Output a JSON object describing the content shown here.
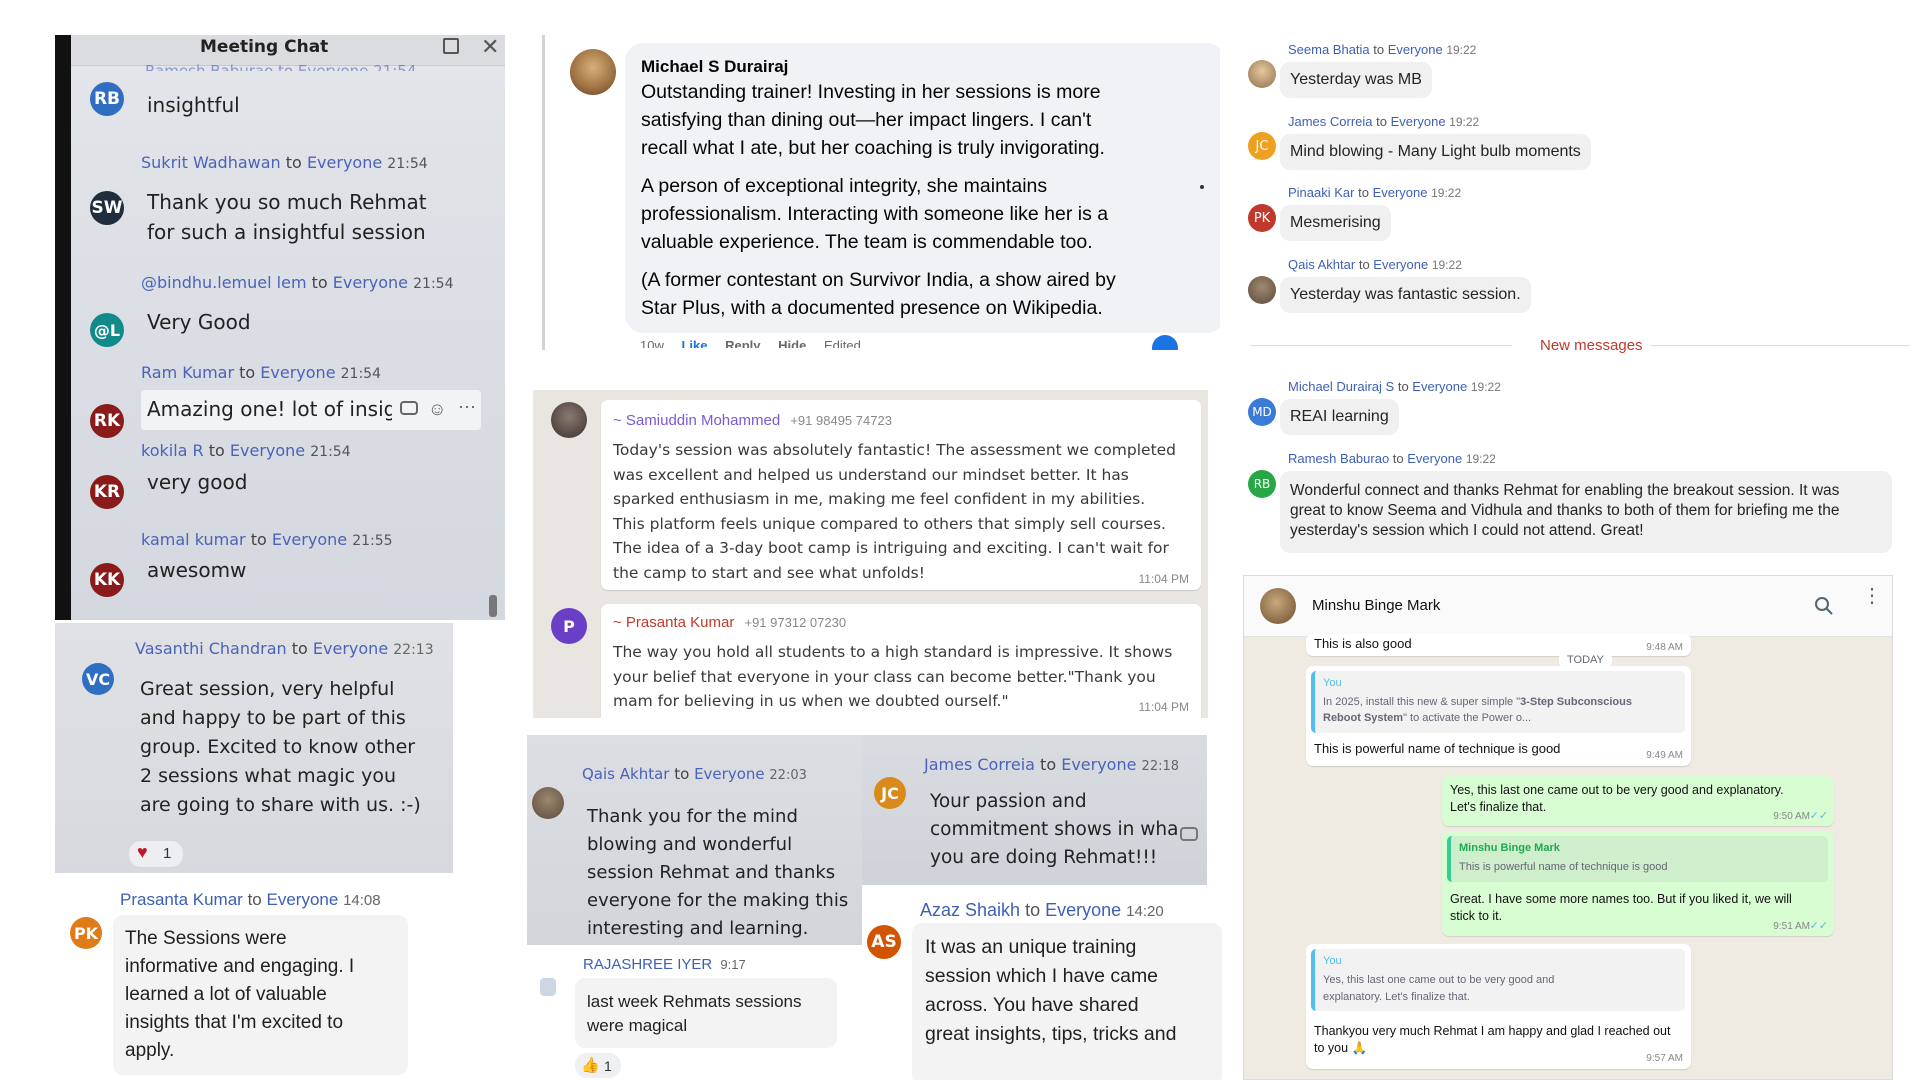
{
  "meeting_chat": {
    "title": "Meeting Chat",
    "cut_sender": "Ramesh Baburao to Everyone 21:54",
    "messages": [
      {
        "initials": "RB",
        "color": "#2f6fc1",
        "sender": "",
        "time": "",
        "text": "insightful"
      },
      {
        "initials": "SW",
        "color": "#1f2d3d",
        "sender": "Sukrit Wadhawan",
        "time": "21:54",
        "text1": "Thank you so much Rehmat",
        "text2": "for such a insightful session"
      },
      {
        "initials": "@L",
        "color": "#128a8a",
        "sender": "@bindhu.lemuel lem",
        "time": "21:54",
        "text": "Very Good"
      },
      {
        "initials": "RK",
        "color": "#8b1a1a",
        "sender": "Ram Kumar",
        "time": "21:54",
        "text": "Amazing one! lot of insig"
      },
      {
        "initials": "KR",
        "color": "#8b1a1a",
        "sender": "kokila R",
        "time": "21:54",
        "text": "very good"
      },
      {
        "initials": "KK",
        "color": "#8b1a1a",
        "sender": "kamal kumar",
        "time": "21:55",
        "text": "awesomw"
      }
    ],
    "to_label": "to",
    "everyone_label": "Everyone"
  },
  "vasanthi": {
    "initials": "VC",
    "sender": "Vasanthi Chandran",
    "time": "22:13",
    "lines": [
      "Great session, very helpful",
      "and happy to be part of this",
      "group. Excited to know other",
      "2 sessions what magic you",
      "are going to share with us. :-)"
    ],
    "reaction_count": "1"
  },
  "prasanta_teams": {
    "initials": "PK",
    "sender": "Prasanta Kumar",
    "time": "14:08",
    "lines": [
      "The  Sessions were",
      "informative and engaging. I",
      "learned a lot of valuable",
      "insights that I'm excited to",
      "apply."
    ]
  },
  "facebook": {
    "author": "Michael S Durairaj",
    "p1": [
      "Outstanding trainer! Investing in her sessions is more",
      "satisfying than dining out—her impact lingers. I can't",
      "recall what I ate, but her coaching is truly invigorating."
    ],
    "p2": [
      "A person of exceptional integrity, she maintains",
      "professionalism. Interacting with someone like her is a",
      "valuable experience. The team is commendable too."
    ],
    "p3": [
      "(A former contestant on Survivor India, a show aired by",
      "Star Plus, with a documented presence on Wikipedia."
    ],
    "footer": [
      "10w",
      "Like",
      "Reply",
      "Hide",
      "Edited"
    ]
  },
  "wa_group": {
    "m1": {
      "sender": "~ Samiuddin Mohammed",
      "phone": "+91 98495 74723",
      "time": "11:04 PM",
      "lines": [
        "Today's session was absolutely fantastic! The assessment we completed",
        "was excellent and helped us understand our mindset better. It has",
        "sparked enthusiasm in me, making me feel confident in my abilities.",
        "This platform feels unique compared to others that simply sell courses.",
        "The idea of a 3-day boot camp is intriguing and exciting. I can't wait for",
        "the camp to start and see what unfolds!"
      ]
    },
    "m2": {
      "initial": "P",
      "sender": "~ Prasanta Kumar",
      "phone": "+91 97312 07230",
      "time": "11:04 PM",
      "lines": [
        "The way you hold all students to a high standard is impressive. It shows",
        "your belief that everyone in your class can become better.\"Thank you",
        "mam for believing in us when we doubted ourself.\""
      ]
    }
  },
  "qais_photo": {
    "sender": "Qais Akhtar",
    "time": "22:03",
    "lines": [
      "Thank you for the mind",
      "blowing and wonderful",
      "session Rehmat and thanks",
      "everyone for the making this",
      "interesting and learning."
    ]
  },
  "james_photo": {
    "initials": "JC",
    "sender": "James Correia",
    "time": "22:18",
    "lines": [
      "Your passion and",
      "commitment shows in wha",
      "you are doing Rehmat!!!"
    ]
  },
  "rajashree": {
    "sender": "RAJASHREE IYER",
    "time": "9:17",
    "lines": [
      "last week Rehmats sessions",
      "were magical"
    ],
    "reaction": "1"
  },
  "azaz": {
    "initials": "AS",
    "sender": "Azaz Shaikh",
    "time": "14:20",
    "lines": [
      "It was an unique training",
      "session which I have came",
      "across. You have shared",
      "great insights, tips, tricks and"
    ]
  },
  "zoom_chat": {
    "messages": [
      {
        "initials": "",
        "color": "#8d6e4a",
        "sender": "Seema Bhatia",
        "time": "19:22",
        "text": "Yesterday was MB"
      },
      {
        "initials": "JC",
        "color": "#f0a020",
        "sender": "James Correia",
        "time": "19:22",
        "text": "Mind blowing - Many Light bulb moments"
      },
      {
        "initials": "PK",
        "color": "#c0392b",
        "sender": "Pinaaki Kar",
        "time": "19:22",
        "text": "Mesmerising"
      },
      {
        "initials": "",
        "color": "#7a6a55",
        "sender": "Qais Akhtar",
        "time": "19:22",
        "text": "Yesterday was fantastic session."
      }
    ],
    "new_messages": "New messages",
    "after": [
      {
        "initials": "MD",
        "color": "#3a7bd5",
        "sender": "Michael Durairaj S",
        "time": "19:22",
        "text": "REAI learning"
      },
      {
        "initials": "RB",
        "color": "#28a745",
        "sender": "Ramesh Baburao",
        "time": "19:22",
        "lines": [
          "Wonderful connect and thanks Rehmat for enabling the breakout session. It was",
          "great to know Seema and Vidhula and thanks to both of them for briefing me the",
          "yesterday's session which I could not attend. Great!"
        ]
      }
    ]
  },
  "whatsapp": {
    "contact": "Minshu Binge Mark",
    "m0": {
      "text": "This is also good",
      "time": "9:48 AM"
    },
    "today": "TODAY",
    "m1": {
      "quote_author": "You",
      "quote_pre": "In 2025, install this new & super simple \"",
      "quote_bold": "3-Step Subconscious Reboot System",
      "quote_post": "\" to activate the Power o...",
      "text": "This is powerful name of technique is good",
      "time": "9:49 AM"
    },
    "m2": {
      "lines": [
        "Yes, this last one came out to be very good and explanatory.",
        "Let's finalize that."
      ],
      "time": "9:50 AM"
    },
    "m3": {
      "quote_author": "Minshu Binge Mark",
      "quote_text": "This is powerful name of technique is good",
      "lines": [
        "Great. I have some more names too. But if you liked it, we will",
        "stick to it."
      ],
      "time": "9:51 AM"
    },
    "m4": {
      "quote_author": "You",
      "quote_lines": [
        "Yes, this last one came out to be very good and",
        "explanatory. Let's finalize that."
      ],
      "lines": [
        "Thankyou very much Rehmat I am happy and glad I reached out",
        "to you 🙏"
      ],
      "time": "9:57 AM"
    }
  }
}
